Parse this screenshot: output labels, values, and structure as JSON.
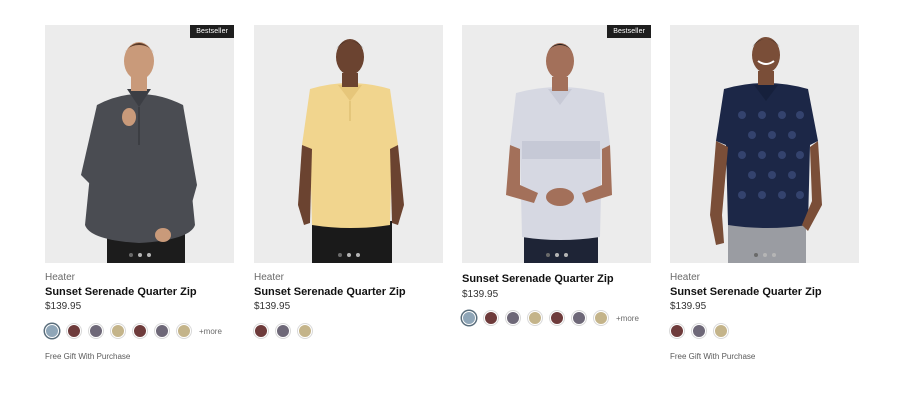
{
  "products": [
    {
      "badge": "Bestseller",
      "brand": "Heater",
      "name": "Sunset Serenade Quarter Zip",
      "price": "$139.95",
      "swatches": [
        "#8fa6b8",
        "#6e3b3b",
        "#6e6878",
        "#c4b48a",
        "#6e3b3b",
        "#6e6878",
        "#c4b48a"
      ],
      "more": "+more",
      "gift": "Free Gift With Purchase",
      "garment_color": "#4a4c52",
      "pants_color": "#1c1c1c",
      "skin_color": "#c99a7a"
    },
    {
      "badge": "",
      "brand": "Heater",
      "name": "Sunset Serenade Quarter Zip",
      "price": "$139.95",
      "swatches": [
        "#6e3b3b",
        "#6e6878",
        "#c4b48a"
      ],
      "more": "",
      "gift": "",
      "garment_color": "#f1d58e",
      "pants_color": "#1a1a1a",
      "skin_color": "#6b4330"
    },
    {
      "badge": "Bestseller",
      "brand": "",
      "name": "Sunset Serenade Quarter Zip",
      "price": "$139.95",
      "swatches": [
        "#8fa6b8",
        "#6e3b3b",
        "#6e6878",
        "#c4b48a",
        "#6e3b3b",
        "#6e6878",
        "#c4b48a"
      ],
      "more": "+more",
      "gift": "",
      "garment_color": "#d6d8e2",
      "pants_color": "#1e2436",
      "skin_color": "#a3705a"
    },
    {
      "badge": "",
      "brand": "Heater",
      "name": "Sunset Serenade Quarter Zip",
      "price": "$139.95",
      "swatches": [
        "#6e3b3b",
        "#6e6878",
        "#c4b48a"
      ],
      "more": "",
      "gift": "Free Gift With Purchase",
      "garment_color": "#1c2747",
      "pants_color": "#9a9ca2",
      "skin_color": "#7a4e38"
    }
  ]
}
